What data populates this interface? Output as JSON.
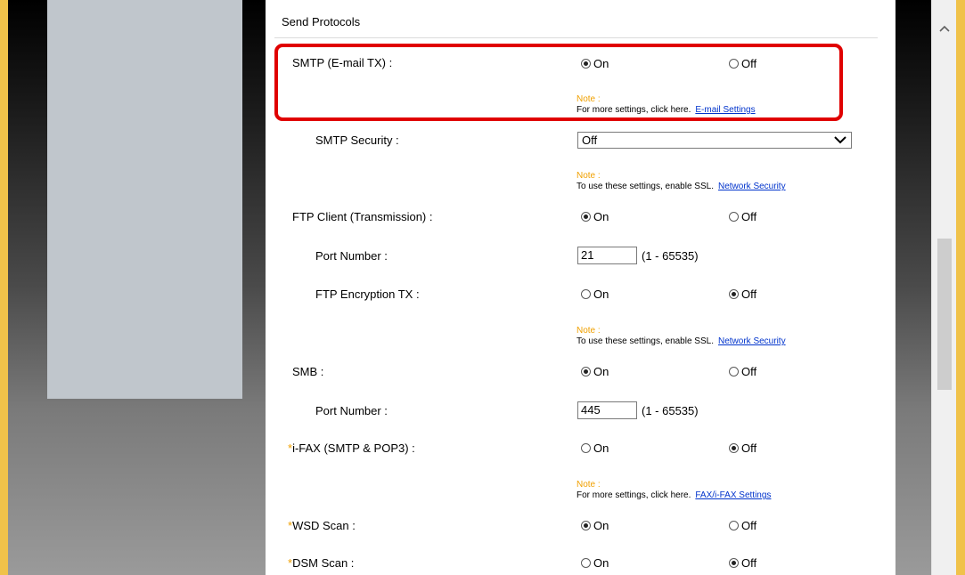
{
  "section_title": "Send Protocols",
  "smtp": {
    "label": "SMTP (E-mail TX) :",
    "on": "On",
    "off": "Off",
    "selected": "On",
    "note_head": "Note :",
    "note_text": "For more settings, click here.",
    "note_link": "E-mail Settings"
  },
  "smtp_security": {
    "label": "SMTP Security :",
    "value": "Off",
    "note_head": "Note :",
    "note_text": "To use these settings, enable SSL.",
    "note_link": "Network Security"
  },
  "ftp_client": {
    "label": "FTP Client (Transmission) :",
    "on": "On",
    "off": "Off",
    "selected": "On"
  },
  "ftp_port": {
    "label": "Port Number :",
    "value": "21",
    "range": "(1 - 65535)"
  },
  "ftp_encryption": {
    "label": "FTP Encryption TX :",
    "on": "On",
    "off": "Off",
    "selected": "Off",
    "note_head": "Note :",
    "note_text": "To use these settings, enable SSL.",
    "note_link": "Network Security"
  },
  "smb": {
    "label": "SMB :",
    "on": "On",
    "off": "Off",
    "selected": "On"
  },
  "smb_port": {
    "label": "Port Number :",
    "value": "445",
    "range": "(1 - 65535)"
  },
  "ifax": {
    "star": "*",
    "label": "i-FAX (SMTP & POP3) :",
    "on": "On",
    "off": "Off",
    "selected": "Off",
    "note_head": "Note :",
    "note_text": "For more settings, click here.",
    "note_link": "FAX/i-FAX Settings"
  },
  "wsd_scan": {
    "star": "*",
    "label": "WSD Scan :",
    "on": "On",
    "off": "Off",
    "selected": "On"
  },
  "dsm_scan": {
    "star": "*",
    "label": "DSM Scan :",
    "on": "On",
    "off": "Off",
    "selected": "Off"
  },
  "colors": {
    "highlight_border": "#e00000",
    "note_head": "#f0a000",
    "link": "#0033cc",
    "frame_orange": "#f0c24a"
  }
}
